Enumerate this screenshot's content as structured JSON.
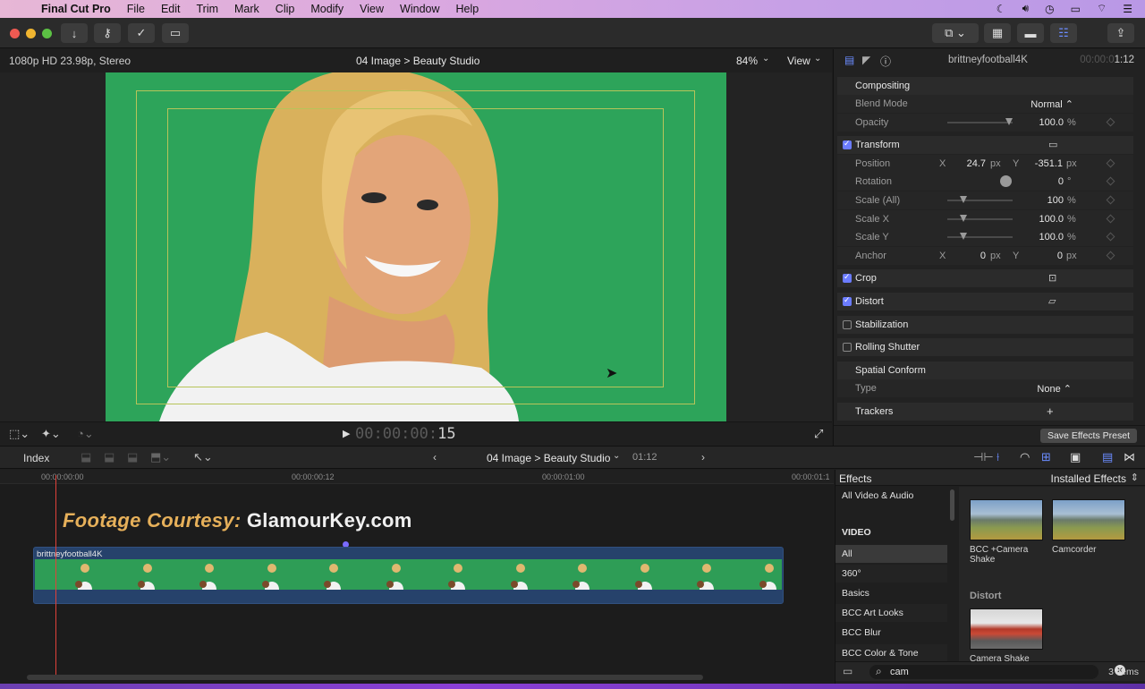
{
  "menubar": {
    "app": "Final Cut Pro",
    "items": [
      "File",
      "Edit",
      "Trim",
      "Mark",
      "Clip",
      "Modify",
      "View",
      "Window",
      "Help"
    ]
  },
  "viewer": {
    "format": "1080p HD 23.98p, Stereo",
    "title": "04 Image > Beauty Studio",
    "zoom": "84%",
    "view_label": "View",
    "timecode_dim": "00:00:00:",
    "timecode_frame": "15"
  },
  "inspector": {
    "clip_name": "brittneyfootball4K",
    "duration_dim": "00:00:0",
    "duration": "1:12",
    "compositing": "Compositing",
    "blend_mode_label": "Blend Mode",
    "blend_mode_value": "Normal ⌃",
    "opacity_label": "Opacity",
    "opacity_value": "100.0",
    "opacity_level": 1.0,
    "percent": "%",
    "transform": "Transform",
    "position_label": "Position",
    "position_x": "24.7",
    "position_y": "-351.1",
    "axis_x": "X",
    "axis_y": "Y",
    "px": "px",
    "rotation_label": "Rotation",
    "rotation_value": "0",
    "degree": "°",
    "scale_all_label": "Scale (All)",
    "scale_all_value": "100",
    "scale_x_label": "Scale X",
    "scale_x_value": "100.0",
    "scale_y_label": "Scale Y",
    "scale_y_value": "100.0",
    "anchor_label": "Anchor",
    "anchor_x": "0",
    "anchor_y": "0",
    "crop": "Crop",
    "distort": "Distort",
    "stabilization": "Stabilization",
    "rolling_shutter": "Rolling Shutter",
    "spatial_conform": "Spatial Conform",
    "type_label": "Type",
    "type_value": "None ⌃",
    "trackers": "Trackers",
    "add": "+",
    "save_preset": "Save Effects Preset"
  },
  "timeline": {
    "index": "Index",
    "project": "04 Image > Beauty Studio",
    "project_duration": "01:12",
    "ruler": [
      "00:00:00:00",
      "00:00:00:12",
      "00:00:01:00",
      "00:00:01:1"
    ],
    "title_part1": "Footage Courtesy: ",
    "title_part2": "GlamourKey.com",
    "clip_name": "brittneyfootball4K"
  },
  "effects": {
    "title": "Effects",
    "installed": "Installed Effects",
    "categories": {
      "all_video_audio": "All Video & Audio",
      "video": "VIDEO",
      "all": "All",
      "c360": "360°",
      "basics": "Basics",
      "bcc_art": "BCC Art Looks",
      "bcc_blur": "BCC Blur",
      "bcc_color": "BCC Color & Tone"
    },
    "items": {
      "bcc_camera_shake": "BCC +Camera Shake",
      "camcorder": "Camcorder",
      "distort_group": "Distort",
      "camera_shake": "Camera Shake"
    },
    "search": "cam",
    "count": "3 items"
  }
}
